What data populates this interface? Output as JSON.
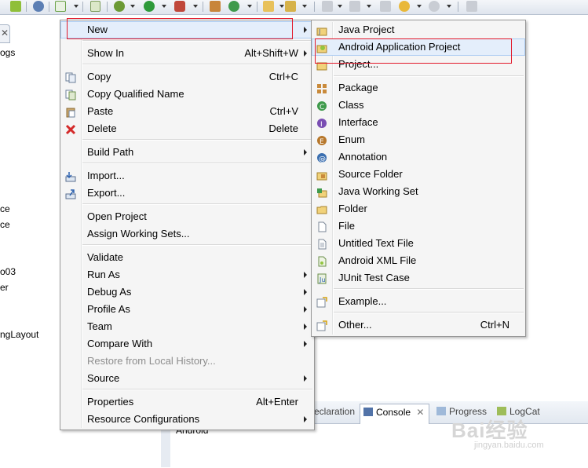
{
  "context_menu": {
    "items": [
      {
        "label": "New",
        "shortcut": "",
        "submenu": true
      },
      {
        "label": "Show In",
        "shortcut": "Alt+Shift+W",
        "submenu": true
      },
      {
        "label": "Copy",
        "shortcut": "Ctrl+C"
      },
      {
        "label": "Copy Qualified Name",
        "shortcut": ""
      },
      {
        "label": "Paste",
        "shortcut": "Ctrl+V"
      },
      {
        "label": "Delete",
        "shortcut": "Delete"
      },
      {
        "label": "Build Path",
        "submenu": true
      },
      {
        "label": "Import..."
      },
      {
        "label": "Export..."
      },
      {
        "label": "Open Project"
      },
      {
        "label": "Assign Working Sets..."
      },
      {
        "label": "Validate"
      },
      {
        "label": "Run As",
        "submenu": true
      },
      {
        "label": "Debug As",
        "submenu": true
      },
      {
        "label": "Profile As",
        "submenu": true
      },
      {
        "label": "Team",
        "submenu": true
      },
      {
        "label": "Compare With",
        "submenu": true
      },
      {
        "label": "Restore from Local History...",
        "disabled": true
      },
      {
        "label": "Source",
        "submenu": true
      },
      {
        "label": "Properties",
        "shortcut": "Alt+Enter"
      },
      {
        "label": "Resource Configurations",
        "submenu": true
      }
    ]
  },
  "new_submenu": {
    "items": [
      {
        "label": "Java Project"
      },
      {
        "label": "Android Application Project"
      },
      {
        "label": "Project..."
      },
      {
        "label": "Package"
      },
      {
        "label": "Class"
      },
      {
        "label": "Interface"
      },
      {
        "label": "Enum"
      },
      {
        "label": "Annotation"
      },
      {
        "label": "Source Folder"
      },
      {
        "label": "Java Working Set"
      },
      {
        "label": "Folder"
      },
      {
        "label": "File"
      },
      {
        "label": "Untitled Text File"
      },
      {
        "label": "Android XML File"
      },
      {
        "label": "JUnit Test Case"
      },
      {
        "label": "Example..."
      },
      {
        "label": "Other...",
        "shortcut": "Ctrl+N"
      }
    ]
  },
  "background": {
    "left_fragments": [
      "ogs",
      "ce",
      "ce",
      "o03",
      "er",
      "ngLayout"
    ],
    "bottom_tabs": [
      "eclaration",
      "Console",
      "Progress",
      "LogCat"
    ],
    "console_text": "Android",
    "watermark": "Bai经验",
    "watermark_url": "jingyan.baidu.com"
  },
  "colors": {
    "highlight_box": "#e2192b",
    "menu_bg": "#f5f5f5",
    "hover_bg": "#e4eefb"
  }
}
